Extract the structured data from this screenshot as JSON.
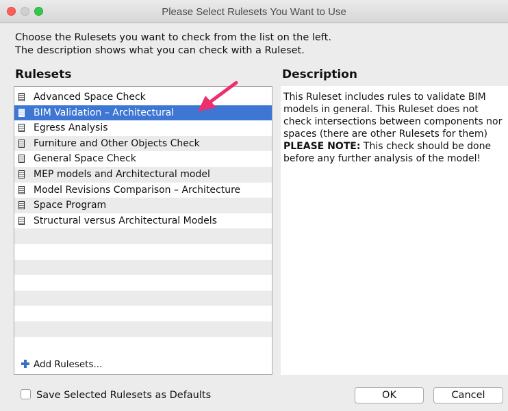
{
  "window": {
    "title": "Please Select Rulesets You Want to Use"
  },
  "intro": {
    "line1": "Choose the Rulesets you want to check from the list on the left.",
    "line2": "The description shows what you can check with a Ruleset."
  },
  "rulesets": {
    "heading": "Rulesets",
    "items": [
      {
        "label": "Advanced Space Check"
      },
      {
        "label": "BIM Validation – Architectural",
        "selected": true
      },
      {
        "label": "Egress Analysis"
      },
      {
        "label": "Furniture and Other Objects Check"
      },
      {
        "label": "General Space Check"
      },
      {
        "label": "MEP models and Architectural model"
      },
      {
        "label": "Model Revisions Comparison – Architecture"
      },
      {
        "label": "Space Program"
      },
      {
        "label": "Structural versus Architectural Models"
      }
    ],
    "add_label": "Add Rulesets..."
  },
  "description": {
    "heading": "Description",
    "text": "This Ruleset includes rules to validate BIM models in general. This Ruleset does not check intersections between components nor spaces (there are other Rulesets for them)",
    "note_label": "PLEASE NOTE:",
    "note_text": " This check should be done before any further analysis of the model!"
  },
  "footer": {
    "checkbox_label": "Save Selected Rulesets as Defaults",
    "checkbox_checked": false,
    "ok_label": "OK",
    "cancel_label": "Cancel"
  },
  "colors": {
    "selection": "#3d76d3",
    "arrow": "#ec2f6e",
    "close": "#fc605c",
    "maximize": "#34c84a"
  },
  "icons": {
    "ruleset_item": "ruleset-book-icon",
    "add": "plus-icon",
    "annotation": "arrow-annotation"
  }
}
